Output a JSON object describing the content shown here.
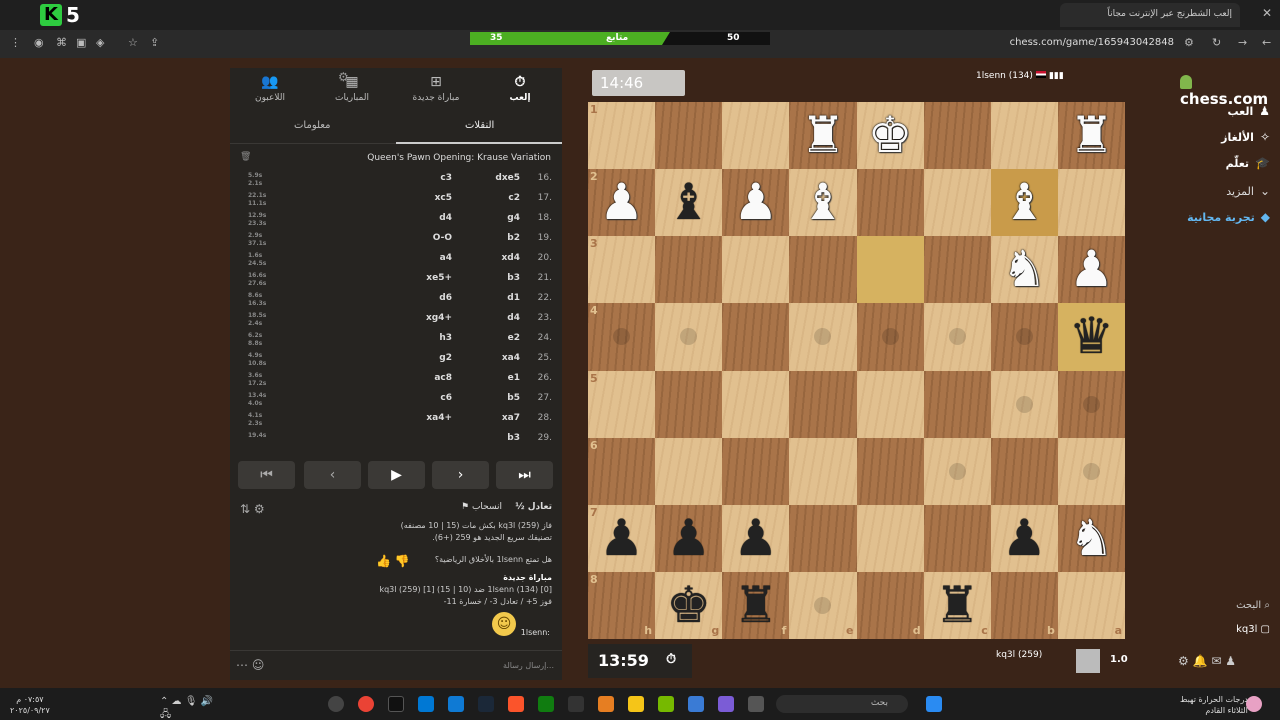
{
  "browser": {
    "tab_title": "إلعب الشطرنج عبر الإنترنت مجاناً",
    "url": "chess.com/game/165943042848"
  },
  "stream_overlay": {
    "left_score": "35",
    "label": "متابع",
    "right_score": "50"
  },
  "game_panel": {
    "tabs": [
      {
        "label": "إلعب",
        "icon": "stopwatch-icon"
      },
      {
        "label": "مباراة جديدة",
        "icon": "plus-square-icon"
      },
      {
        "label": "المباريات",
        "icon": "board-icon"
      },
      {
        "label": "اللاعبون",
        "icon": "players-icon"
      }
    ],
    "subtabs": {
      "moves": "النقلات",
      "info": "معلومات"
    },
    "opening": "Queen's Pawn Opening: Krause Variation",
    "moves": [
      {
        "num": "16.",
        "white": "dxe5",
        "black": "c3"
      },
      {
        "num": "17.",
        "white": "c2",
        "black": "xc5"
      },
      {
        "num": "18.",
        "white": "g4",
        "black": "d4"
      },
      {
        "num": "19.",
        "white": "b2",
        "black": "O-O"
      },
      {
        "num": "20.",
        "white": "xd4",
        "black": "a4"
      },
      {
        "num": "21.",
        "white": "b3",
        "black": "xe5+"
      },
      {
        "num": "22.",
        "white": "d1",
        "black": "d6"
      },
      {
        "num": "23.",
        "white": "d4",
        "black": "xg4+"
      },
      {
        "num": "24.",
        "white": "e2",
        "black": "h3"
      },
      {
        "num": "25.",
        "white": "xa4",
        "black": "g2"
      },
      {
        "num": "26.",
        "white": "e1",
        "black": "ac8"
      },
      {
        "num": "27.",
        "white": "b5",
        "black": "c6"
      },
      {
        "num": "28.",
        "white": "xa7",
        "black": "xa4+"
      },
      {
        "num": "29.",
        "white": "b3",
        "black": ""
      }
    ],
    "move_times": [
      [
        "5.9s",
        "2.1s"
      ],
      [
        "22.1s",
        "11.1s"
      ],
      [
        "12.9s",
        "23.3s"
      ],
      [
        "2.9s",
        "37.1s"
      ],
      [
        "1.6s",
        "24.5s"
      ],
      [
        "16.6s",
        "27.6s"
      ],
      [
        "8.6s",
        "16.3s"
      ],
      [
        "18.5s",
        "2.4s"
      ],
      [
        "6.2s",
        "8.8s"
      ],
      [
        "4.9s",
        "10.8s"
      ],
      [
        "3.6s",
        "17.2s"
      ],
      [
        "13.4s",
        "4.0s"
      ],
      [
        "4.1s",
        "2.3s"
      ],
      [
        "19.4s",
        ""
      ]
    ],
    "controls": {
      "first": "⏮",
      "prev": "‹",
      "play": "▶",
      "next": "›",
      "last": "⏭"
    },
    "actions": {
      "draw": "½ تعادل",
      "resign": "انسحاب"
    },
    "result_line1": "فاز kq3l (259) بكش مات (15 | 10 مصنفه)",
    "result_line2": "تصنيفك سريع الجديد هو 259 (+6).",
    "rate_question": "هل تمتع 1lsenn بالأخلاق الرياضية؟",
    "new_game_title": "مباراة جديدة",
    "new_game_line": "[0] (134) 1lsenn ضد (10 | 15) [1] (259) kq3l",
    "record_line": "فوز 5+ / تعادل 3- / خسارة 11-",
    "chat_user": "1lsenn:",
    "chat_placeholder": "إرسال رسالة..."
  },
  "board": {
    "top_timer": "14:46",
    "top_player": "1lsenn (134)",
    "bottom_timer": "13:59",
    "bottom_player": "kq3l (259)",
    "bottom_score": "1.0",
    "rank_labels": [
      "1",
      "2",
      "3",
      "4",
      "5",
      "6",
      "7",
      "8"
    ],
    "file_labels": [
      "h",
      "g",
      "f",
      "e",
      "d",
      "c",
      "b",
      "a"
    ],
    "pieces": [
      [
        ".",
        ".",
        ".",
        "R",
        "K",
        ".",
        ".",
        "R"
      ],
      [
        "P",
        "b",
        "P",
        "B",
        ".",
        ".",
        "B",
        "."
      ],
      [
        ".",
        ".",
        ".",
        ".",
        ".",
        ".",
        "N",
        "P"
      ],
      [
        ".",
        ".",
        ".",
        ".",
        ".",
        ".",
        ".",
        "q"
      ],
      [
        ".",
        ".",
        ".",
        ".",
        ".",
        ".",
        ".",
        "."
      ],
      [
        ".",
        ".",
        ".",
        ".",
        ".",
        ".",
        ".",
        "."
      ],
      [
        "p",
        "p",
        "p",
        ".",
        ".",
        ".",
        "p",
        "N"
      ],
      [
        ".",
        "k",
        "r",
        ".",
        ".",
        "r",
        ".",
        "."
      ]
    ],
    "highlighted_squares": [
      "2-4",
      "3-7",
      "1-6"
    ],
    "move_dots": [
      "3-0",
      "3-1",
      "3-3",
      "3-4",
      "3-5",
      "3-6",
      "4-6",
      "4-7",
      "5-5",
      "5-7",
      "7-3"
    ]
  },
  "sidebar": {
    "brand": "chess.com",
    "nav": [
      {
        "label": "العب",
        "icon": "pawn-icon",
        "style": "bold"
      },
      {
        "label": "الألغاز",
        "icon": "puzzle-icon",
        "style": "bold"
      },
      {
        "label": "تعلّم",
        "icon": "learn-icon",
        "style": "bold"
      },
      {
        "label": "المزيد",
        "icon": "more-icon",
        "style": "muted"
      },
      {
        "label": "تجربة مجانية",
        "icon": "diamond-icon",
        "style": "accent"
      }
    ],
    "search": "البحث",
    "username": "kq3l"
  },
  "taskbar": {
    "search_placeholder": "بحث",
    "weather_line1": "درجات الحرارة تهبط",
    "weather_line2": "الثلاثاء القادم",
    "time": "٠٧:٥٧ م",
    "date": "٢٠٢٥/٠٩/٢٧"
  },
  "colors": {
    "light_square": "#e1c08f",
    "dark_square": "#a97449",
    "panel_bg": "#262421",
    "accent_green": "#81b64c"
  }
}
